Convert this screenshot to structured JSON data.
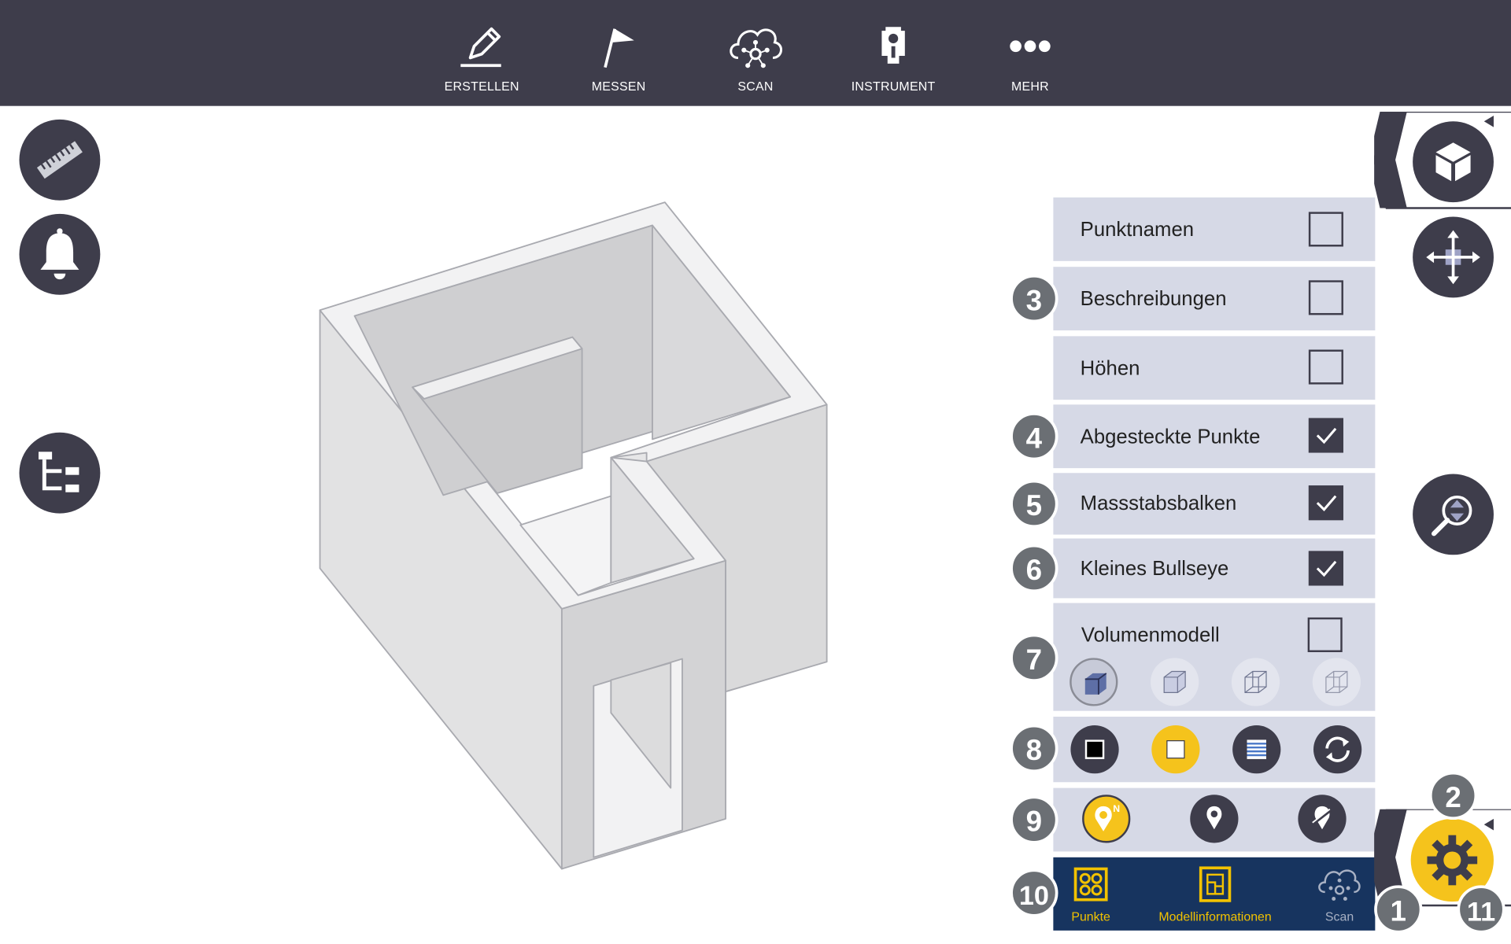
{
  "toolbar": {
    "items": [
      {
        "label": "ERSTELLEN",
        "icon": "pencil-icon"
      },
      {
        "label": "MESSEN",
        "icon": "flag-icon"
      },
      {
        "label": "SCAN",
        "icon": "cloud-scan-icon"
      },
      {
        "label": "INSTRUMENT",
        "icon": "instrument-icon"
      },
      {
        "label": "MEHR",
        "icon": "more-icon"
      }
    ]
  },
  "left_tools": [
    "ruler-icon",
    "bell-icon",
    "tree-icon"
  ],
  "right_tools": [
    "view-cube-icon",
    "pan-icon",
    "zoom-extents-icon"
  ],
  "settings": {
    "rows": [
      {
        "label": "Punktnamen",
        "checked": false
      },
      {
        "label": "Beschreibungen",
        "checked": false
      },
      {
        "label": "Höhen",
        "checked": false
      },
      {
        "label": "Abgesteckte Punkte",
        "checked": true
      },
      {
        "label": "Massstabsbalken",
        "checked": true
      },
      {
        "label": "Kleines Bullseye",
        "checked": true
      },
      {
        "label": "Volumenmodell",
        "checked": false
      }
    ]
  },
  "bottom_tabs": [
    {
      "label": "Punkte",
      "icon": "points-icon"
    },
    {
      "label": "Modellinformationen",
      "icon": "model-info-icon"
    },
    {
      "label": "Scan",
      "icon": "scan-icon"
    }
  ],
  "callouts": [
    "1",
    "2",
    "3",
    "4",
    "5",
    "6",
    "7",
    "8",
    "9",
    "10",
    "11"
  ],
  "colors": {
    "toolbar_bg": "#3e3d4b",
    "panel_bg": "#d6d9e6",
    "accent_yellow": "#f5c31c",
    "tabbar_bg": "#17345f",
    "callout_bg": "#6b6f74"
  }
}
